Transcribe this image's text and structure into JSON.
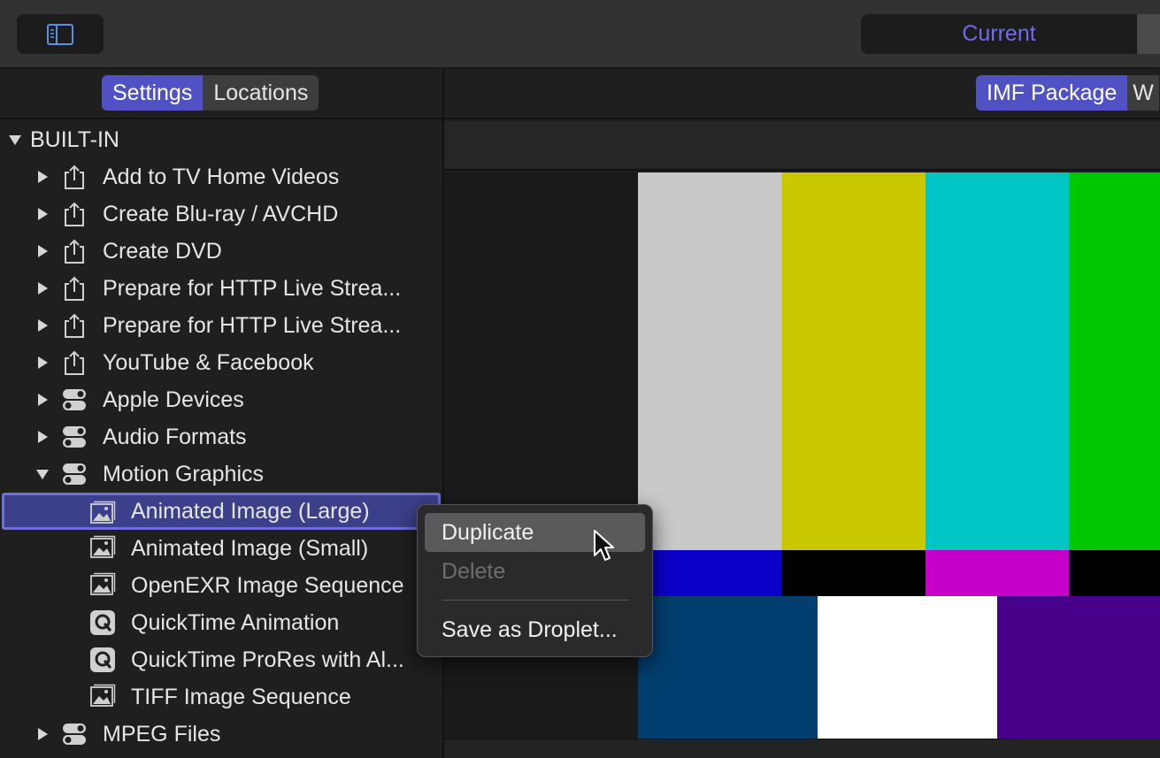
{
  "toolbar": {
    "current_tab": "Current"
  },
  "left_panel": {
    "tabs": [
      "Settings",
      "Locations"
    ],
    "active_tab": "Settings"
  },
  "right_panel": {
    "format_tabs": [
      "IMF Package",
      "W"
    ],
    "active_format": "IMF Package"
  },
  "tree": {
    "group": "BUILT-IN",
    "items": [
      {
        "label": "Add to TV Home Videos",
        "icon": "share-icon",
        "level": 1,
        "expandable": true,
        "expanded": false
      },
      {
        "label": "Create Blu-ray / AVCHD",
        "icon": "share-icon",
        "level": 1,
        "expandable": true,
        "expanded": false
      },
      {
        "label": "Create DVD",
        "icon": "share-icon",
        "level": 1,
        "expandable": true,
        "expanded": false
      },
      {
        "label": "Prepare for HTTP Live Strea...",
        "icon": "share-icon",
        "level": 1,
        "expandable": true,
        "expanded": false
      },
      {
        "label": "Prepare for HTTP Live Strea...",
        "icon": "share-icon",
        "level": 1,
        "expandable": true,
        "expanded": false
      },
      {
        "label": "YouTube & Facebook",
        "icon": "share-icon",
        "level": 1,
        "expandable": true,
        "expanded": false
      },
      {
        "label": "Apple Devices",
        "icon": "toggle-group-icon",
        "level": 1,
        "expandable": true,
        "expanded": false
      },
      {
        "label": "Audio Formats",
        "icon": "toggle-group-icon",
        "level": 1,
        "expandable": true,
        "expanded": false
      },
      {
        "label": "Motion Graphics",
        "icon": "toggle-group-icon",
        "level": 1,
        "expandable": true,
        "expanded": true
      },
      {
        "label": "Animated Image (Large)",
        "icon": "image-stack-icon",
        "level": 2,
        "expandable": false,
        "selected": true
      },
      {
        "label": "Animated Image (Small)",
        "icon": "image-stack-icon",
        "level": 2,
        "expandable": false
      },
      {
        "label": "OpenEXR Image Sequence",
        "icon": "image-stack-icon",
        "level": 2,
        "expandable": false
      },
      {
        "label": "QuickTime Animation",
        "icon": "quicktime-icon",
        "level": 2,
        "expandable": false
      },
      {
        "label": "QuickTime ProRes with Al...",
        "icon": "quicktime-icon",
        "level": 2,
        "expandable": false
      },
      {
        "label": "TIFF Image Sequence",
        "icon": "image-stack-icon",
        "level": 2,
        "expandable": false
      },
      {
        "label": "MPEG Files",
        "icon": "toggle-group-icon",
        "level": 1,
        "expandable": true,
        "expanded": false
      }
    ]
  },
  "context_menu": {
    "items": [
      {
        "label": "Duplicate",
        "state": "hover"
      },
      {
        "label": "Delete",
        "state": "disabled"
      },
      {
        "label": "Save as Droplet...",
        "state": "normal"
      }
    ]
  },
  "colors": {
    "accent": "#4f51c5",
    "accent_text": "#6f6cf2",
    "selection_fill": "#3c3f8a",
    "selection_border": "#6c70d8"
  },
  "color_bars": {
    "top": [
      "#c9c9c9",
      "#c8c700",
      "#00c5c5",
      "#00c800"
    ],
    "middle": [
      "#0b00c9",
      "#000000",
      "#c600c8",
      "#000000"
    ],
    "bottom": [
      "#003f6f",
      "#ffffff",
      "#46008a"
    ]
  }
}
